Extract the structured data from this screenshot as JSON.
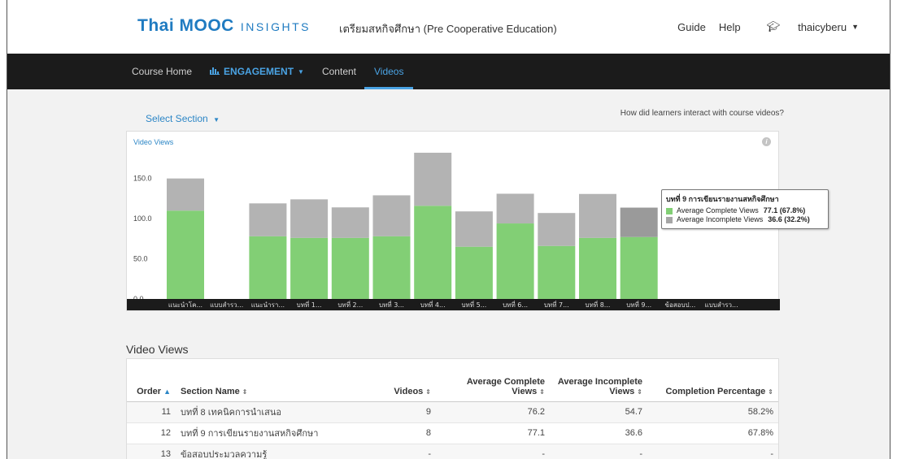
{
  "header": {
    "brand_main": "Thai MOOC",
    "brand_sub": "INSIGHTS",
    "course_title": "เตรียมสหกิจศึกษา (Pre Cooperative Education)",
    "links": {
      "guide": "Guide",
      "help": "Help",
      "username": "thaicyberu"
    }
  },
  "nav": {
    "course_home": "Course Home",
    "engagement": "ENGAGEMENT",
    "content": "Content",
    "videos": "Videos"
  },
  "page": {
    "select_section": "Select Section",
    "question": "How did learners interact with course videos?"
  },
  "chart": {
    "title": "Video Views",
    "info_icon": "i",
    "tooltip": {
      "title": "บทที่ 9 การเขียนรายงานสหกิจศึกษา",
      "rows": [
        {
          "label": "Average Complete Views",
          "value": "77.1 (67.8%)",
          "color": "#82cf75"
        },
        {
          "label": "Average Incomplete Views",
          "value": "36.6 (32.2%)",
          "color": "#a6a6a6"
        }
      ]
    }
  },
  "chart_data": {
    "type": "bar",
    "stacked": true,
    "title": "Video Views",
    "categories": [
      "แนะนำโค...",
      "แบบสำรว...",
      "แนะนำรา...",
      "บทที่ 1...",
      "บทที่ 2...",
      "บทที่ 3...",
      "บทที่ 4...",
      "บทที่ 5...",
      "บทที่ 6...",
      "บทที่ 7...",
      "บทที่ 8...",
      "บทที่ 9...",
      "ข้อสอบป...",
      "แบบสำรว..."
    ],
    "series": [
      {
        "name": "Average Complete Views",
        "color": "#82cf75",
        "values": [
          110,
          0,
          78,
          76,
          76,
          78,
          116,
          65,
          94,
          66,
          76,
          77.1,
          0,
          0
        ]
      },
      {
        "name": "Average Incomplete Views",
        "color": "#b3b3b3",
        "values": [
          40,
          0,
          41,
          48,
          38,
          51,
          66,
          44,
          37,
          41,
          54.7,
          36.6,
          0,
          0
        ]
      }
    ],
    "y_ticks": [
      "0.0",
      "50.0",
      "100.0",
      "150.0"
    ],
    "ylim": [
      0,
      180
    ],
    "highlighted_index": 11,
    "highlight_color": "#9a9a9a"
  },
  "table": {
    "heading": "Video Views",
    "columns": [
      "Order",
      "Section Name",
      "Videos",
      "Average Complete Views",
      "Average Incomplete Views",
      "Completion Percentage"
    ],
    "rows": [
      [
        "11",
        "บทที่ 8 เทคนิคการนำเสนอ",
        "9",
        "76.2",
        "54.7",
        "58.2%"
      ],
      [
        "12",
        "บทที่ 9 การเขียนรายงานสหกิจศึกษา",
        "8",
        "77.1",
        "36.6",
        "67.8%"
      ],
      [
        "13",
        "ข้อสอบประมวลความรู้",
        "-",
        "-",
        "-",
        "-"
      ]
    ]
  }
}
